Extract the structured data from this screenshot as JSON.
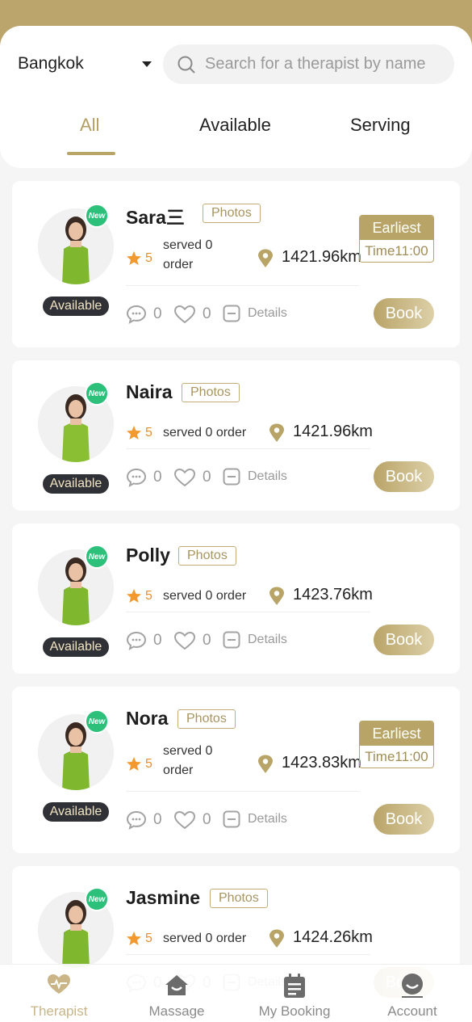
{
  "header": {
    "city": "Bangkok",
    "search_placeholder": "Search for a therapist by name",
    "tabs": [
      {
        "label": "All",
        "active": true
      },
      {
        "label": "Available",
        "active": false
      },
      {
        "label": "Serving",
        "active": false
      }
    ]
  },
  "therapists": [
    {
      "name": "Sara三",
      "photos_label": "Photos",
      "rating": "5",
      "served": "served 0 order",
      "served_wrapped": true,
      "distance": "1421.96km",
      "status": "Available",
      "new_badge": "New",
      "earliest": {
        "title": "Earliest",
        "time": "Time11:00"
      },
      "comments": "0",
      "likes": "0",
      "details_label": "Details",
      "book_label": "Book"
    },
    {
      "name": "Naira",
      "photos_label": "Photos",
      "rating": "5",
      "served": "served 0 order",
      "served_wrapped": false,
      "distance": "1421.96km",
      "status": "Available",
      "new_badge": "New",
      "earliest": null,
      "comments": "0",
      "likes": "0",
      "details_label": "Details",
      "book_label": "Book"
    },
    {
      "name": "Polly",
      "photos_label": "Photos",
      "rating": "5",
      "served": "served 0 order",
      "served_wrapped": false,
      "distance": "1423.76km",
      "status": "Available",
      "new_badge": "New",
      "earliest": null,
      "comments": "0",
      "likes": "0",
      "details_label": "Details",
      "book_label": "Book"
    },
    {
      "name": "Nora",
      "photos_label": "Photos",
      "rating": "5",
      "served": "served 0 order",
      "served_wrapped": true,
      "distance": "1423.83km",
      "status": "Available",
      "new_badge": "New",
      "earliest": {
        "title": "Earliest",
        "time": "Time11:00"
      },
      "comments": "0",
      "likes": "0",
      "details_label": "Details",
      "book_label": "Book"
    },
    {
      "name": "Jasmine",
      "photos_label": "Photos",
      "rating": "5",
      "served": "served 0 order",
      "served_wrapped": false,
      "distance": "1424.26km",
      "status": "",
      "new_badge": "New",
      "earliest": null,
      "comments": "0",
      "likes": "0",
      "details_label": "Details",
      "book_label": "Book"
    }
  ],
  "bottom_nav": [
    {
      "label": "Therapist",
      "icon": "heart-hand-icon",
      "active": true
    },
    {
      "label": "Massage",
      "icon": "spa-icon",
      "active": false
    },
    {
      "label": "My Booking",
      "icon": "calendar-icon",
      "active": false
    },
    {
      "label": "Account",
      "icon": "user-icon",
      "active": false
    }
  ],
  "colors": {
    "accent": "#b9a468",
    "header_band": "#bba56c",
    "new_badge": "#2cc07a",
    "status_badge": "#2f3136",
    "star": "#f29a2e"
  }
}
